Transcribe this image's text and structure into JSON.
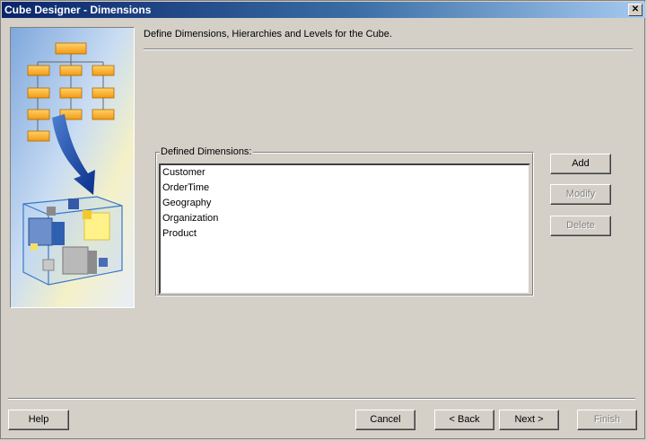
{
  "window": {
    "title": "Cube Designer - Dimensions",
    "close_symbol": "✕"
  },
  "main": {
    "heading": "Define Dimensions, Hierarchies and Levels for the Cube.",
    "group_label": "Defined Dimensions:",
    "dimensions": [
      "Customer",
      "OrderTime",
      "Geography",
      "Organization",
      "Product"
    ]
  },
  "side_buttons": {
    "add": "Add",
    "modify": "Modify",
    "delete": "Delete"
  },
  "footer": {
    "help": "Help",
    "cancel": "Cancel",
    "back": "< Back",
    "next": "Next >",
    "finish": "Finish"
  }
}
